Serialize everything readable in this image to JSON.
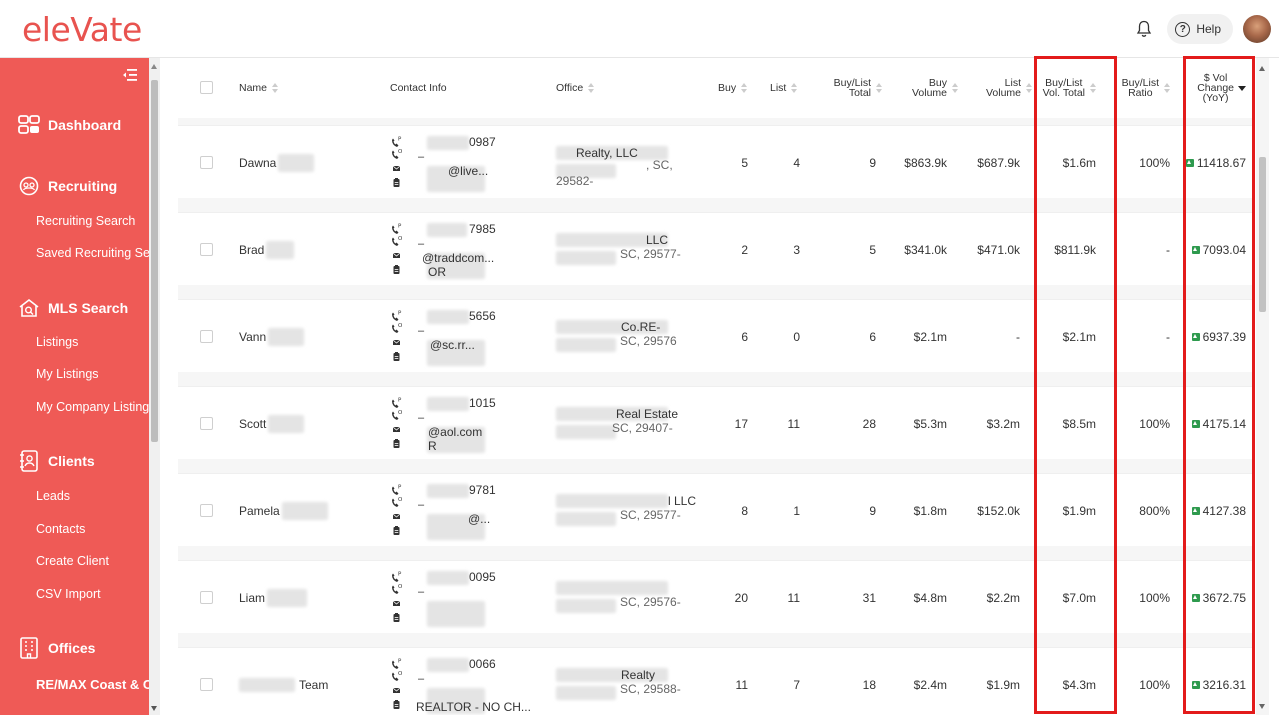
{
  "app": {
    "logo_text": "eleVate",
    "help_label": "Help"
  },
  "sidebar": {
    "sections": [
      {
        "label": "Dashboard",
        "icon": "dashboard-icon"
      },
      {
        "label": "Recruiting",
        "icon": "recruiting-icon",
        "items": [
          "Recruiting Search",
          "Saved Recruiting Search"
        ]
      },
      {
        "label": "MLS Search",
        "icon": "mls-search-icon",
        "items": [
          "Listings",
          "My Listings",
          "My Company Listings"
        ]
      },
      {
        "label": "Clients",
        "icon": "clients-icon",
        "items": [
          "Leads",
          "Contacts",
          "Create Client",
          "CSV Import"
        ]
      },
      {
        "label": "Offices",
        "icon": "offices-icon",
        "items": [
          "RE/MAX Coast & Cou"
        ]
      }
    ]
  },
  "table": {
    "columns": {
      "name": "Name",
      "contact": "Contact Info",
      "office": "Office",
      "buy": "Buy",
      "list": "List",
      "bl_total_1": "Buy/List",
      "bl_total_2": "Total",
      "buy_vol_1": "Buy",
      "buy_vol_2": "Volume",
      "list_vol_1": "List",
      "list_vol_2": "Volume",
      "bl_vol_1": "Buy/List",
      "bl_vol_2": "Vol. Total",
      "ratio_1": "Buy/List",
      "ratio_2": "Ratio",
      "chg_1": "$ Vol",
      "chg_2": "Change",
      "chg_3": "(YoY)"
    },
    "contact_labels": {
      "phone_p": "P",
      "phone_o": "O",
      "dash": "–"
    },
    "rows": [
      {
        "name": "Dawna",
        "phone": "0987",
        "email": "@live...",
        "extra": "",
        "office1": "Realty, LLC",
        "office2": ", SC,",
        "office3": "29582-",
        "buy": "5",
        "list": "4",
        "total": "9",
        "buy_vol": "$863.9k",
        "list_vol": "$687.9k",
        "bl_vol": "$1.6m",
        "ratio": "100%",
        "change": "11418.67"
      },
      {
        "name": "Brad",
        "phone": "7985",
        "email": "@traddcom...",
        "extra": "OR",
        "office1": "LLC",
        "office2": "SC, 29577-",
        "office3": "",
        "buy": "2",
        "list": "3",
        "total": "5",
        "buy_vol": "$341.0k",
        "list_vol": "$471.0k",
        "bl_vol": "$811.9k",
        "ratio": "-",
        "change": "7093.04"
      },
      {
        "name": "Vann",
        "phone": "5656",
        "email": "@sc.rr...",
        "extra": "",
        "office1": "Co.RE-",
        "office2": "SC, 29576",
        "office3": "",
        "buy": "6",
        "list": "0",
        "total": "6",
        "buy_vol": "$2.1m",
        "list_vol": "-",
        "bl_vol": "$2.1m",
        "ratio": "-",
        "change": "6937.39"
      },
      {
        "name": "Scott",
        "phone": "1015",
        "email": "@aol.com",
        "extra": "R",
        "office1": "Real Estate",
        "office2": "SC, 29407-",
        "office3": "",
        "buy": "17",
        "list": "11",
        "total": "28",
        "buy_vol": "$5.3m",
        "list_vol": "$3.2m",
        "bl_vol": "$8.5m",
        "ratio": "100%",
        "change": "4175.14"
      },
      {
        "name": "Pamela",
        "phone": "9781",
        "email": "@...",
        "extra": "",
        "office1": "l LLC",
        "office2": "SC, 29577-",
        "office3": "",
        "buy": "8",
        "list": "1",
        "total": "9",
        "buy_vol": "$1.8m",
        "list_vol": "$152.0k",
        "bl_vol": "$1.9m",
        "ratio": "800%",
        "change": "4127.38"
      },
      {
        "name": "Liam",
        "phone": "0095",
        "email": "",
        "extra": "",
        "office1": "",
        "office2": "SC, 29576-",
        "office3": "",
        "buy": "20",
        "list": "11",
        "total": "31",
        "buy_vol": "$4.8m",
        "list_vol": "$2.2m",
        "bl_vol": "$7.0m",
        "ratio": "100%",
        "change": "3672.75"
      },
      {
        "name": "Team",
        "phone": "0066",
        "email": "",
        "extra": "REALTOR - NO CH...",
        "office1": "Realty",
        "office2": "SC, 29588-",
        "office3": "",
        "buy": "11",
        "list": "7",
        "total": "18",
        "buy_vol": "$2.4m",
        "list_vol": "$1.9m",
        "bl_vol": "$4.3m",
        "ratio": "100%",
        "change": "3216.31"
      }
    ]
  },
  "colors": {
    "brand": "#ef5a56",
    "highlight": "#e31b1b",
    "positive": "#2e9a4e"
  }
}
